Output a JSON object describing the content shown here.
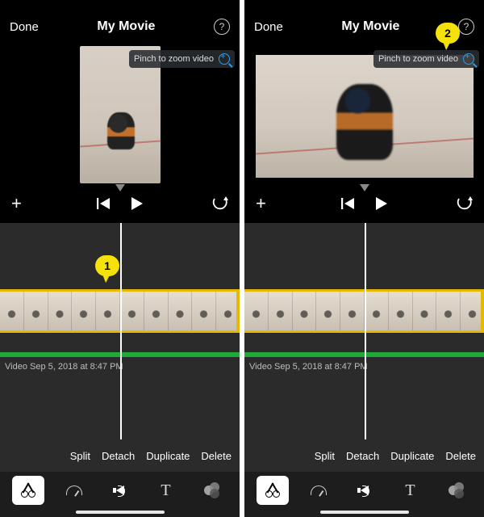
{
  "header": {
    "done": "Done",
    "title": "My Movie",
    "help_glyph": "?"
  },
  "preview": {
    "zoom_hint": "Pinch to zoom video"
  },
  "timeline": {
    "meta": "Video Sep 5, 2018 at 8:47 PM"
  },
  "callouts": {
    "left": "1",
    "right": "2"
  },
  "clip_actions": {
    "split": "Split",
    "detach": "Detach",
    "duplicate": "Duplicate",
    "delete": "Delete"
  },
  "toolbar": {
    "text_glyph": "T"
  }
}
